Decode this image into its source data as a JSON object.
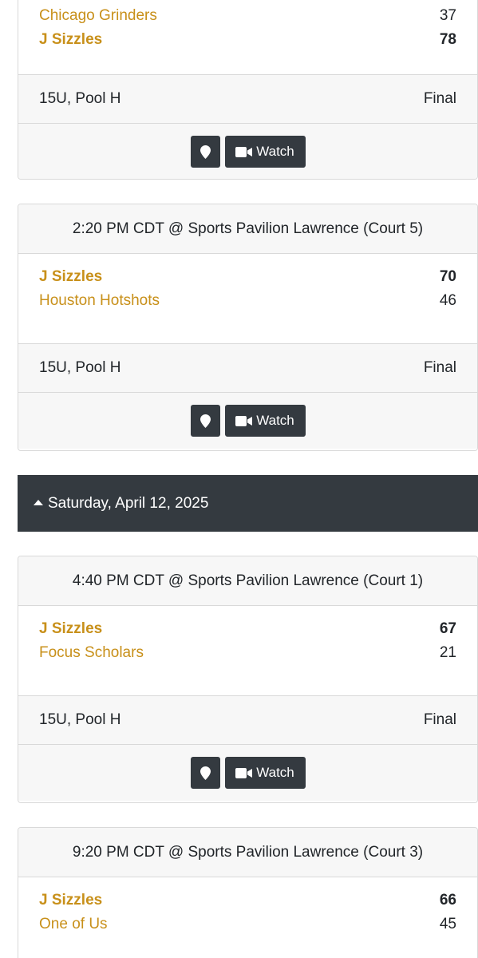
{
  "game1": {
    "team1": {
      "name": "Chicago Grinders",
      "score": "37"
    },
    "team2": {
      "name": "J Sizzles",
      "score": "78"
    },
    "division": "15U, Pool H",
    "status": "Final",
    "watch_label": "Watch"
  },
  "game2": {
    "header": "2:20 PM CDT @ Sports Pavilion Lawrence (Court 5)",
    "team1": {
      "name": "J Sizzles",
      "score": "70"
    },
    "team2": {
      "name": "Houston Hotshots",
      "score": "46"
    },
    "division": "15U, Pool H",
    "status": "Final",
    "watch_label": "Watch"
  },
  "day_header": {
    "label": "Saturday, April 12, 2025"
  },
  "game3": {
    "header": "4:40 PM CDT @ Sports Pavilion Lawrence (Court 1)",
    "team1": {
      "name": "J Sizzles",
      "score": "67"
    },
    "team2": {
      "name": "Focus Scholars",
      "score": "21"
    },
    "division": "15U, Pool H",
    "status": "Final",
    "watch_label": "Watch"
  },
  "game4": {
    "header": "9:20 PM CDT @ Sports Pavilion Lawrence (Court 3)",
    "team1": {
      "name": "J Sizzles",
      "score": "66"
    },
    "team2": {
      "name": "One of Us",
      "score": "45"
    }
  },
  "colors": {
    "team_link": "#c8901a",
    "dark_button": "#343a40",
    "panel_bg": "#f7f7f7"
  },
  "icons": {
    "map": "map-marker-icon",
    "video": "video-camera-icon",
    "toggle": "caret-up-icon"
  }
}
